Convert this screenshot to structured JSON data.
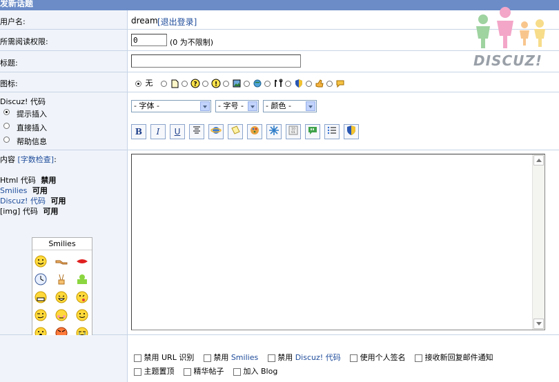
{
  "title": "发新话题",
  "username": {
    "label": "用户名:",
    "value": "dream",
    "logout": "[退出登录]"
  },
  "readperm": {
    "label": "所需阅读权限:",
    "value": "0",
    "hint": "(0 为不限制)"
  },
  "subject": {
    "label": "标题:",
    "value": ""
  },
  "icons": {
    "label": "图标:",
    "none_label": "无"
  },
  "discuzcode": {
    "label": "Discuz! 代码",
    "modes": [
      "提示插入",
      "直接插入",
      "帮助信息"
    ],
    "font_select": "- 字体 -",
    "size_select": "- 字号 -",
    "color_select": "- 颜色 -"
  },
  "content": {
    "label": "内容",
    "check": "[字数检查]",
    "colon": ":",
    "html_code": "Html 代码",
    "html_state": "禁用",
    "smilies": "Smilies",
    "smilies_state": "可用",
    "discuz": "Discuz! 代码",
    "discuz_state": "可用",
    "img": "[img] 代码",
    "img_state": "可用"
  },
  "smilies_box": {
    "title": "Smilies"
  },
  "options": {
    "disable_url": "禁用 URL 识别",
    "disable_smilies_prefix": "禁用",
    "disable_smilies": "Smilies",
    "disable_discuz_prefix": "禁用",
    "disable_discuz": "Discuz! 代码",
    "use_sig": "使用个人签名",
    "email_notify": "接收新回复邮件通知",
    "top": "主题置顶",
    "digest": "精华帖子",
    "blog": "加入 Blog"
  },
  "logo_text": "DISCUZ!",
  "colors": {
    "header": "#6b8cc7",
    "label_bg": "#f0f4fa",
    "border": "#c6d3e6",
    "link": "#1e4b9a"
  }
}
